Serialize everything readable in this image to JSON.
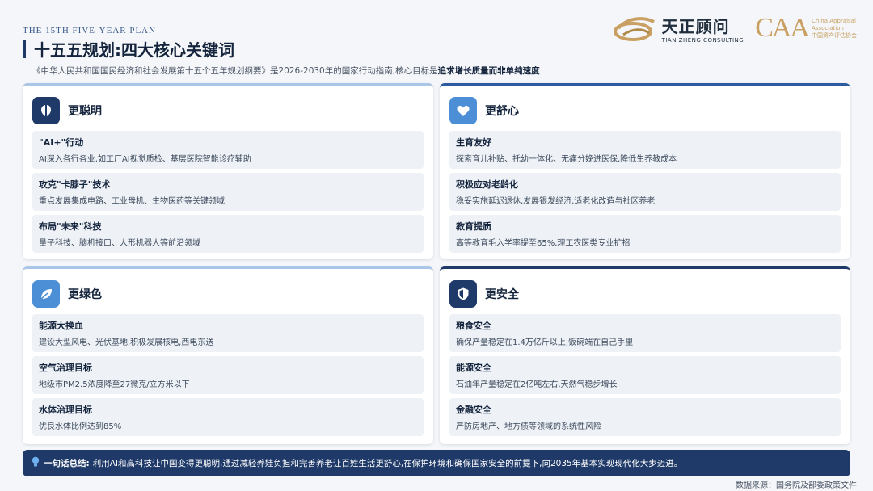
{
  "header": {
    "eyebrow": "THE 15TH FIVE-YEAR PLAN",
    "title": "十五五规划:四大核心关键词",
    "subtitle_prefix": "《中华人民共和国国民经济和社会发展第十五个五年规划纲要》是2026-2030年的国家行动指南,核心目标是",
    "subtitle_emphasis": "追求增长质量而非单纯速度"
  },
  "logos": {
    "logo1_cn": "天正顾问",
    "logo1_en": "TIAN ZHENG CONSULTING",
    "logo2_mark": "CAA",
    "logo2_line1": "China Appraisal",
    "logo2_line2": "Association",
    "logo2_line3": "中国资产评估协会"
  },
  "cards": [
    {
      "title": "更聪明",
      "icon": "brain-icon",
      "items": [
        {
          "title": "\"AI+\"行动",
          "desc": "AI深入各行各业,如工厂AI视觉质检、基层医院智能诊疗辅助"
        },
        {
          "title": "攻克\"卡脖子\"技术",
          "desc": "重点发展集成电路、工业母机、生物医药等关键领域"
        },
        {
          "title": "布局\"未来\"科技",
          "desc": "量子科技、脑机接口、人形机器人等前沿领域"
        }
      ]
    },
    {
      "title": "更舒心",
      "icon": "heart-icon",
      "items": [
        {
          "title": "生育友好",
          "desc": "探索育儿补贴、托幼一体化、无痛分娩进医保,降低生养教成本"
        },
        {
          "title": "积极应对老龄化",
          "desc": "稳妥实施延迟退休,发展银发经济,适老化改造与社区养老"
        },
        {
          "title": "教育提质",
          "desc": "高等教育毛入学率提至65%,理工农医类专业扩招"
        }
      ]
    },
    {
      "title": "更绿色",
      "icon": "leaf-icon",
      "items": [
        {
          "title": "能源大换血",
          "desc": "建设大型风电、光伏基地,积极发展核电,西电东送"
        },
        {
          "title": "空气治理目标",
          "desc": "地级市PM2.5浓度降至27微克/立方米以下"
        },
        {
          "title": "水体治理目标",
          "desc": "优良水体比例达到85%"
        }
      ]
    },
    {
      "title": "更安全",
      "icon": "shield-icon",
      "items": [
        {
          "title": "粮食安全",
          "desc": "确保产量稳定在1.4万亿斤以上,饭碗端在自己手里"
        },
        {
          "title": "能源安全",
          "desc": "石油年产量稳定在2亿吨左右,天然气稳步增长"
        },
        {
          "title": "金融安全",
          "desc": "严防房地产、地方债等领域的系统性风险"
        }
      ]
    }
  ],
  "summary": {
    "icon": "lightbulb-icon",
    "label": "一句话总结:",
    "text": "利用AI和高科技让中国变得更聪明,通过减轻养娃负担和完善养老让百姓生活更舒心,在保护环境和确保国家安全的前提下,向2035年基本实现现代化大步迈进。"
  },
  "source": "数据来源：国务院及部委政策文件",
  "colors": {
    "navy": "#1f3a68",
    "light_blue": "#4d8fd6",
    "gold": "#c9a062"
  }
}
